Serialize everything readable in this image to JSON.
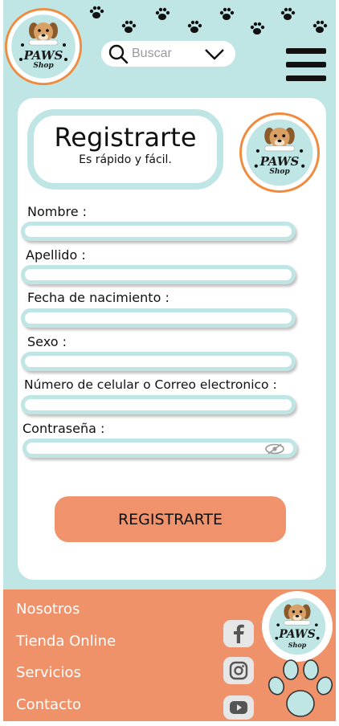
{
  "header": {
    "logo": {
      "line1": "PAWS",
      "line2": "Shop",
      "icon": "dog-logo-icon"
    },
    "search": {
      "placeholder": "Buscar",
      "icon": "search-icon",
      "dropdown_icon": "chevron-down-icon"
    },
    "menu_icon": "hamburger-menu-icon"
  },
  "form": {
    "title": "Registrarte",
    "subtitle": "Es rápido y fácil.",
    "logo": {
      "line1": "PAWS",
      "line2": "Shop"
    },
    "fields": {
      "nombre": "Nombre :",
      "apellido": "Apellido :",
      "fecha": "Fecha de nacimiento :",
      "sexo": "Sexo :",
      "contacto": "Número de celular o Correo electronico :",
      "contrasena": "Contraseña :"
    },
    "password_toggle_icon": "eye-slash-icon",
    "submit_label": "REGISTRARTE"
  },
  "footer": {
    "links": {
      "nosotros": "Nosotros",
      "tienda": "Tienda Online",
      "servicios": "Servicios",
      "contacto": "Contacto"
    },
    "logo": {
      "line1": "PAWS",
      "line2": "Shop"
    },
    "social_icons": [
      "facebook-icon",
      "instagram-icon",
      "youtube-icon"
    ]
  },
  "colors": {
    "background": "#bfe5e5",
    "accent": "#ef9169",
    "button": "#f0926b",
    "logo_ring": "#f08a3c"
  }
}
